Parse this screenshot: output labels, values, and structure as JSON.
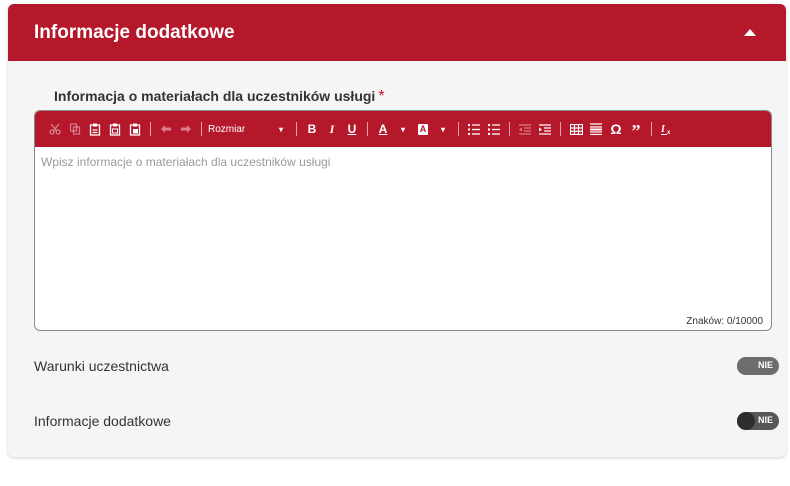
{
  "section": {
    "title": "Informacje dodatkowe"
  },
  "materials_field": {
    "label": "Informacja o materiałach dla uczestników usługi",
    "required_mark": "*",
    "placeholder": "Wpisz informacje o materiałach dla uczestników usługi",
    "counter": "Znaków: 0/10000"
  },
  "toolbar": {
    "size_label": "Rozmiar",
    "bold": "B",
    "italic": "I",
    "underline": "U",
    "text_color": "A",
    "bg_color": "A",
    "special_char": "Ω",
    "blockquote": "”"
  },
  "toggles": [
    {
      "label": "Warunki uczestnictwa",
      "state": "NIE",
      "track_color": "#6d6d6d",
      "knob_color": "#6d6d6d"
    },
    {
      "label": "Informacje dodatkowe",
      "state": "NIE",
      "track_color": "#575757",
      "knob_color": "#2e2e2e"
    }
  ],
  "colors": {
    "brand": "#b5172b",
    "required": "#c8102e"
  }
}
